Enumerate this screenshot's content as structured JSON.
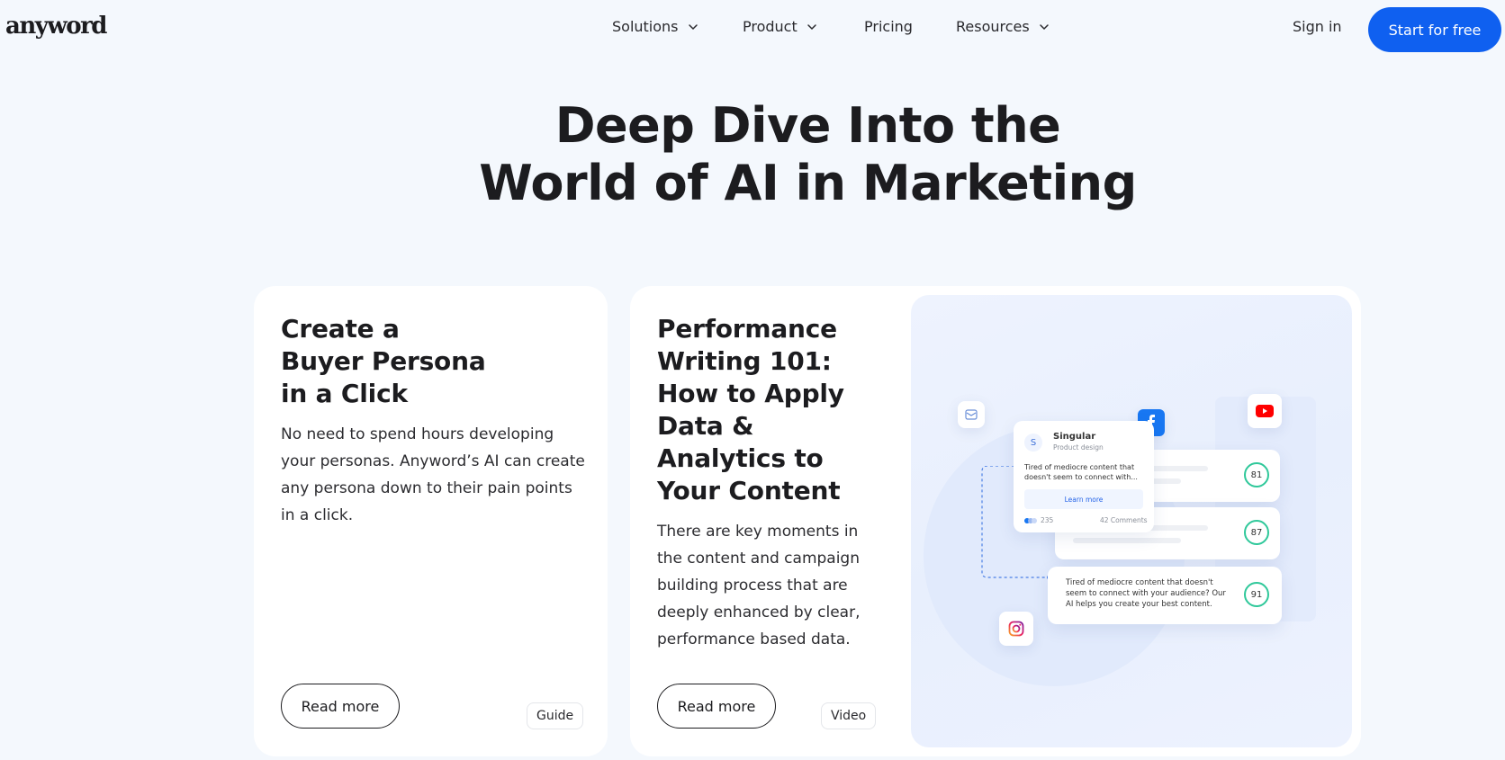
{
  "brand": {
    "logo": "anyword",
    "accent": "#0f60f0"
  },
  "nav": {
    "items": [
      {
        "label": "Solutions",
        "dropdown": true
      },
      {
        "label": "Product",
        "dropdown": true
      },
      {
        "label": "Pricing",
        "dropdown": false
      },
      {
        "label": "Resources",
        "dropdown": true
      }
    ],
    "sign_in": "Sign in",
    "cta": "Start for free"
  },
  "hero": {
    "title_line1": "Deep Dive Into the",
    "title_line2": "World of AI in Marketing"
  },
  "cards": [
    {
      "title": "Create a Buyer Persona in a Click",
      "description": "No need to spend hours developing your personas. Anyword’s AI can create any persona down to their pain points in a click.",
      "button": "Read more",
      "tag": "Guide"
    },
    {
      "title": "Performance Writing 101: How to Apply Data & Analytics to Your Content",
      "description": "There are key moments in the content and campaign building process that are deeply enhanced by clear, performance based data.",
      "button": "Read more",
      "tag": "Video"
    }
  ],
  "illustration": {
    "post": {
      "avatar": "S",
      "name": "Singular",
      "subtitle": "Product design",
      "text": "Tired of mediocre content that doesn't seem to connect with...",
      "button": "Learn more",
      "reactions": "235",
      "comments": "42 Comments"
    },
    "scores": [
      "81",
      "87",
      "91"
    ],
    "bottom_text": "Tired of mediocre content that doesn't seem to connect with your audience? Our AI helps you create your best content."
  }
}
